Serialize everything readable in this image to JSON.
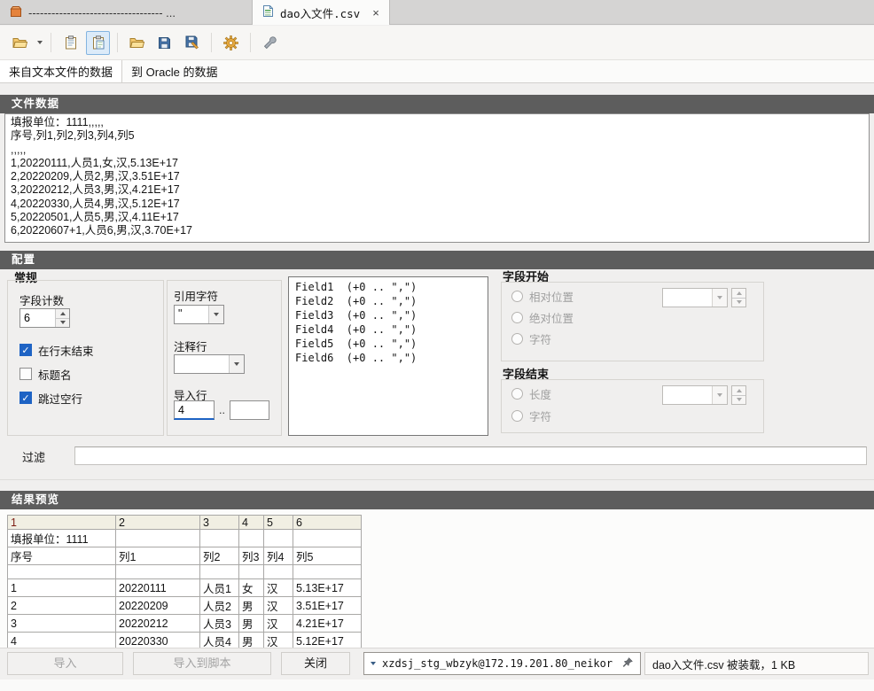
{
  "tabs": {
    "previous": {
      "label": "----------------------------------- ..."
    },
    "current": {
      "label": "dao入文件.csv",
      "close": "×"
    }
  },
  "toolbar": {
    "icons": [
      "open-file",
      "copy",
      "paste",
      "open-template",
      "save",
      "save-edit",
      "settings",
      "tools"
    ]
  },
  "breadcrumb": {
    "source": "来自文本文件的数据",
    "target": "到 Oracle 的数据"
  },
  "file_data": {
    "title": "文件数据",
    "lines": [
      "填报单位：1111,,,,,",
      "序号,列1,列2,列3,列4,列5",
      ",,,,,",
      "1,20220111,人员1,女,汉,5.13E+17",
      "2,20220209,人员2,男,汉,3.51E+17",
      "3,20220212,人员3,男,汉,4.21E+17",
      "4,20220330,人员4,男,汉,5.12E+17",
      "5,20220501,人员5,男,汉,4.11E+17",
      "6,20220607+1,人员6,男,汉,3.70E+17"
    ]
  },
  "config": {
    "title": "配置",
    "general_title": "常规",
    "field_count": {
      "label": "字段计数",
      "value": "6"
    },
    "checkboxes": [
      {
        "label": "在行末结束",
        "checked": true
      },
      {
        "label": "标题名",
        "checked": false
      },
      {
        "label": "跳过空行",
        "checked": true
      }
    ],
    "quote": {
      "label": "引用字符",
      "value": "\""
    },
    "comment": {
      "label": "注释行",
      "value": ""
    },
    "import_row": {
      "label": "导入行",
      "from": "4",
      "separator": "..",
      "to": ""
    },
    "fields_list": [
      "Field1  (+0 .. \",\")",
      "Field2  (+0 .. \",\")",
      "Field3  (+0 .. \",\")",
      "Field4  (+0 .. \",\")",
      "Field5  (+0 .. \",\")",
      "Field6  (+0 .. \",\")"
    ],
    "field_start": {
      "title": "字段开始",
      "options": [
        "相对位置",
        "绝对位置",
        "字符"
      ],
      "value": ""
    },
    "field_end": {
      "title": "字段结束",
      "options": [
        "长度",
        "字符"
      ],
      "value": ""
    }
  },
  "filter": {
    "label": "过滤",
    "value": ""
  },
  "preview": {
    "title": "结果预览",
    "header": [
      "1",
      "2",
      "3",
      "4",
      "5",
      "6"
    ],
    "rows": [
      [
        "填报单位：1111",
        "",
        "",
        "",
        "",
        ""
      ],
      [
        "序号",
        "列1",
        "列2",
        "列3",
        "列4",
        "列5"
      ],
      [
        "",
        "",
        "",
        "",
        "",
        ""
      ],
      [
        "1",
        "20220111",
        "人员1",
        "女",
        "汉",
        "5.13E+17"
      ],
      [
        "2",
        "20220209",
        "人员2",
        "男",
        "汉",
        "3.51E+17"
      ],
      [
        "3",
        "20220212",
        "人员3",
        "男",
        "汉",
        "4.21E+17"
      ],
      [
        "4",
        "20220330",
        "人员4",
        "男",
        "汉",
        "5.12E+17"
      ]
    ]
  },
  "footer": {
    "import": "导入",
    "import_to_script": "导入到脚本",
    "close": "关闭",
    "connection": "xzdsj_stg_wbzyk@172.19.201.80_neikor",
    "status": "dao入文件.csv 被装载，1 KB"
  }
}
